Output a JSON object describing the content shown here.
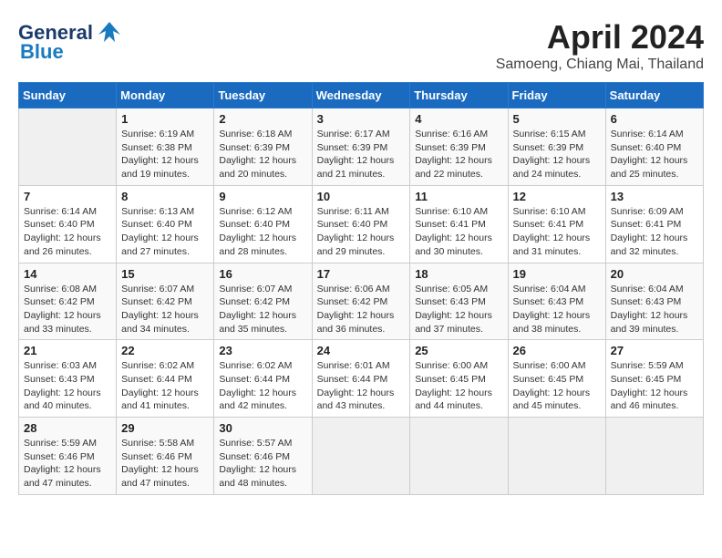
{
  "header": {
    "logo_general": "General",
    "logo_blue": "Blue",
    "month_title": "April 2024",
    "location": "Samoeng, Chiang Mai, Thailand"
  },
  "days_of_week": [
    "Sunday",
    "Monday",
    "Tuesday",
    "Wednesday",
    "Thursday",
    "Friday",
    "Saturday"
  ],
  "weeks": [
    [
      {
        "day": "",
        "info": ""
      },
      {
        "day": "1",
        "info": "Sunrise: 6:19 AM\nSunset: 6:38 PM\nDaylight: 12 hours\nand 19 minutes."
      },
      {
        "day": "2",
        "info": "Sunrise: 6:18 AM\nSunset: 6:39 PM\nDaylight: 12 hours\nand 20 minutes."
      },
      {
        "day": "3",
        "info": "Sunrise: 6:17 AM\nSunset: 6:39 PM\nDaylight: 12 hours\nand 21 minutes."
      },
      {
        "day": "4",
        "info": "Sunrise: 6:16 AM\nSunset: 6:39 PM\nDaylight: 12 hours\nand 22 minutes."
      },
      {
        "day": "5",
        "info": "Sunrise: 6:15 AM\nSunset: 6:39 PM\nDaylight: 12 hours\nand 24 minutes."
      },
      {
        "day": "6",
        "info": "Sunrise: 6:14 AM\nSunset: 6:40 PM\nDaylight: 12 hours\nand 25 minutes."
      }
    ],
    [
      {
        "day": "7",
        "info": "Sunrise: 6:14 AM\nSunset: 6:40 PM\nDaylight: 12 hours\nand 26 minutes."
      },
      {
        "day": "8",
        "info": "Sunrise: 6:13 AM\nSunset: 6:40 PM\nDaylight: 12 hours\nand 27 minutes."
      },
      {
        "day": "9",
        "info": "Sunrise: 6:12 AM\nSunset: 6:40 PM\nDaylight: 12 hours\nand 28 minutes."
      },
      {
        "day": "10",
        "info": "Sunrise: 6:11 AM\nSunset: 6:40 PM\nDaylight: 12 hours\nand 29 minutes."
      },
      {
        "day": "11",
        "info": "Sunrise: 6:10 AM\nSunset: 6:41 PM\nDaylight: 12 hours\nand 30 minutes."
      },
      {
        "day": "12",
        "info": "Sunrise: 6:10 AM\nSunset: 6:41 PM\nDaylight: 12 hours\nand 31 minutes."
      },
      {
        "day": "13",
        "info": "Sunrise: 6:09 AM\nSunset: 6:41 PM\nDaylight: 12 hours\nand 32 minutes."
      }
    ],
    [
      {
        "day": "14",
        "info": "Sunrise: 6:08 AM\nSunset: 6:42 PM\nDaylight: 12 hours\nand 33 minutes."
      },
      {
        "day": "15",
        "info": "Sunrise: 6:07 AM\nSunset: 6:42 PM\nDaylight: 12 hours\nand 34 minutes."
      },
      {
        "day": "16",
        "info": "Sunrise: 6:07 AM\nSunset: 6:42 PM\nDaylight: 12 hours\nand 35 minutes."
      },
      {
        "day": "17",
        "info": "Sunrise: 6:06 AM\nSunset: 6:42 PM\nDaylight: 12 hours\nand 36 minutes."
      },
      {
        "day": "18",
        "info": "Sunrise: 6:05 AM\nSunset: 6:43 PM\nDaylight: 12 hours\nand 37 minutes."
      },
      {
        "day": "19",
        "info": "Sunrise: 6:04 AM\nSunset: 6:43 PM\nDaylight: 12 hours\nand 38 minutes."
      },
      {
        "day": "20",
        "info": "Sunrise: 6:04 AM\nSunset: 6:43 PM\nDaylight: 12 hours\nand 39 minutes."
      }
    ],
    [
      {
        "day": "21",
        "info": "Sunrise: 6:03 AM\nSunset: 6:43 PM\nDaylight: 12 hours\nand 40 minutes."
      },
      {
        "day": "22",
        "info": "Sunrise: 6:02 AM\nSunset: 6:44 PM\nDaylight: 12 hours\nand 41 minutes."
      },
      {
        "day": "23",
        "info": "Sunrise: 6:02 AM\nSunset: 6:44 PM\nDaylight: 12 hours\nand 42 minutes."
      },
      {
        "day": "24",
        "info": "Sunrise: 6:01 AM\nSunset: 6:44 PM\nDaylight: 12 hours\nand 43 minutes."
      },
      {
        "day": "25",
        "info": "Sunrise: 6:00 AM\nSunset: 6:45 PM\nDaylight: 12 hours\nand 44 minutes."
      },
      {
        "day": "26",
        "info": "Sunrise: 6:00 AM\nSunset: 6:45 PM\nDaylight: 12 hours\nand 45 minutes."
      },
      {
        "day": "27",
        "info": "Sunrise: 5:59 AM\nSunset: 6:45 PM\nDaylight: 12 hours\nand 46 minutes."
      }
    ],
    [
      {
        "day": "28",
        "info": "Sunrise: 5:59 AM\nSunset: 6:46 PM\nDaylight: 12 hours\nand 47 minutes."
      },
      {
        "day": "29",
        "info": "Sunrise: 5:58 AM\nSunset: 6:46 PM\nDaylight: 12 hours\nand 47 minutes."
      },
      {
        "day": "30",
        "info": "Sunrise: 5:57 AM\nSunset: 6:46 PM\nDaylight: 12 hours\nand 48 minutes."
      },
      {
        "day": "",
        "info": ""
      },
      {
        "day": "",
        "info": ""
      },
      {
        "day": "",
        "info": ""
      },
      {
        "day": "",
        "info": ""
      }
    ]
  ]
}
